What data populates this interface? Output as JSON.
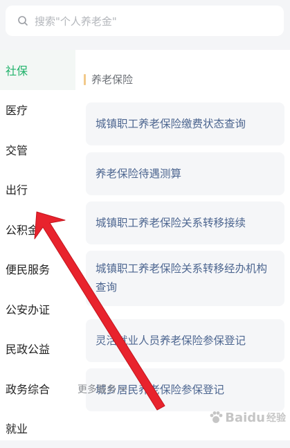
{
  "search": {
    "placeholder": "搜索\"个人养老金\""
  },
  "sidebar": {
    "items": [
      {
        "label": "社保",
        "active": true
      },
      {
        "label": "医疗",
        "active": false
      },
      {
        "label": "交管",
        "active": false
      },
      {
        "label": "出行",
        "active": false
      },
      {
        "label": "公积金",
        "active": false
      },
      {
        "label": "便民服务",
        "active": false
      },
      {
        "label": "公安办证",
        "active": false
      },
      {
        "label": "民政公益",
        "active": false
      },
      {
        "label": "政务综合",
        "active": false
      },
      {
        "label": "就业",
        "active": false
      }
    ]
  },
  "content": {
    "section_title": "养老保险",
    "cards": [
      {
        "label": "城镇职工养老保险缴费状态查询"
      },
      {
        "label": "养老保险待遇测算"
      },
      {
        "label": "城镇职工养老保险关系转移接续"
      },
      {
        "label": "城镇职工养老保险关系转移经办机构查询"
      },
      {
        "label": "灵活就业人员养老保险参保登记"
      },
      {
        "label": "城乡居民养老保险参保登记"
      }
    ],
    "more_label": "更多服务"
  },
  "watermark": {
    "brand": "Baidu",
    "sub": "经验"
  },
  "colors": {
    "accent": "#1fb26a",
    "card_text": "#4d6690",
    "arrow": "#e8232d"
  }
}
